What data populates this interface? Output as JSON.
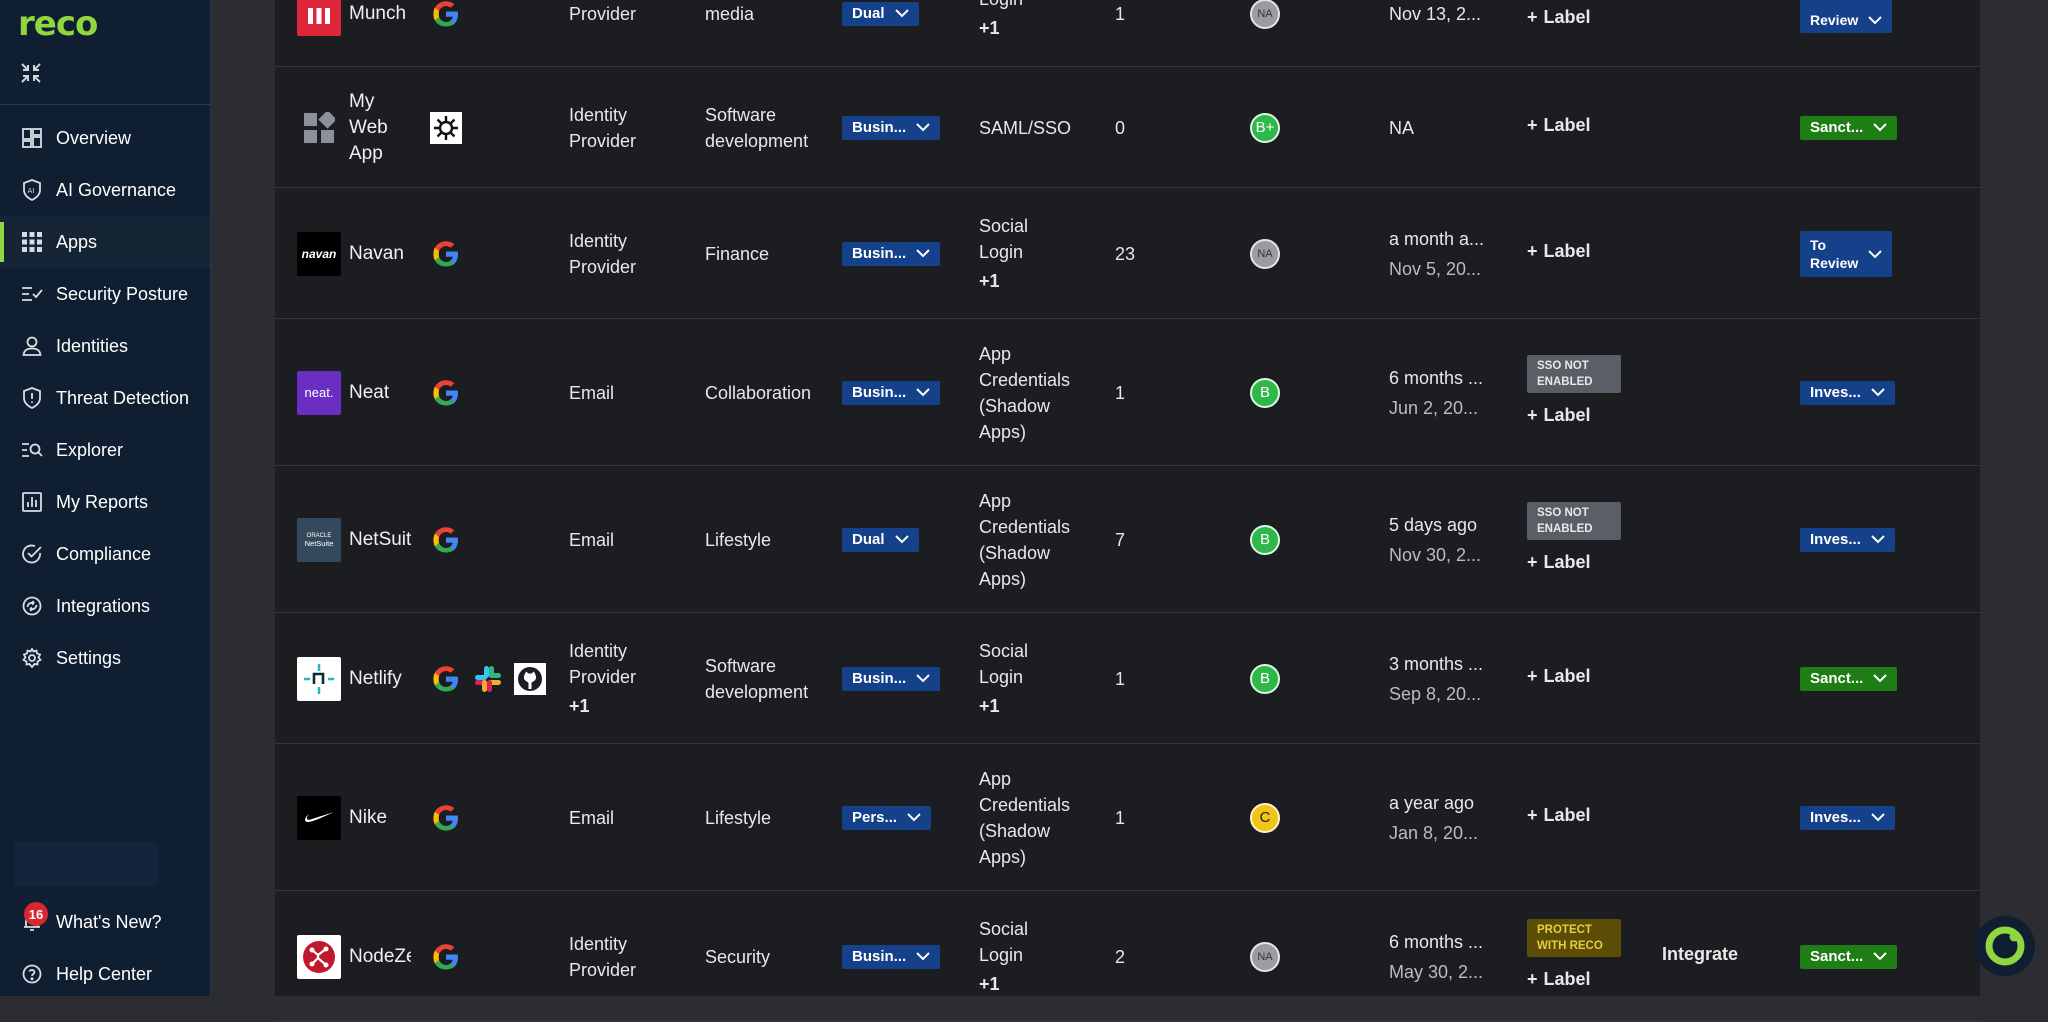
{
  "brand": {
    "logo_text": "reco",
    "accent": "#8fd640"
  },
  "sidebar": {
    "items": [
      {
        "label": "Overview",
        "icon": "dashboard-icon"
      },
      {
        "label": "AI Governance",
        "icon": "ai-shield-icon"
      },
      {
        "label": "Apps",
        "icon": "apps-grid-icon",
        "active": true
      },
      {
        "label": "Security Posture",
        "icon": "checklist-icon"
      },
      {
        "label": "Identities",
        "icon": "person-icon"
      },
      {
        "label": "Threat Detection",
        "icon": "alert-shield-icon"
      },
      {
        "label": "Explorer",
        "icon": "search-list-icon"
      },
      {
        "label": "My Reports",
        "icon": "bar-chart-icon"
      },
      {
        "label": "Compliance",
        "icon": "check-circle-icon"
      },
      {
        "label": "Integrations",
        "icon": "sync-icon"
      },
      {
        "label": "Settings",
        "icon": "gear-icon"
      }
    ],
    "whats_new": {
      "label": "What's New?",
      "badge": "16"
    },
    "help": {
      "label": "Help Center"
    }
  },
  "add_label": "Label",
  "rows": [
    {
      "name": "Munch",
      "logo": "munch",
      "idps": [
        "google"
      ],
      "type_lines": [
        "Provider"
      ],
      "type_more": "",
      "category_lines": [
        "media"
      ],
      "account": "Dual",
      "method_lines": [
        "Login"
      ],
      "method_more": "+1",
      "users": "1",
      "score": "NA",
      "last_lines": [
        "Nov 13, 2..."
      ],
      "tag": "",
      "integrate": "",
      "status": "Review",
      "status_two": "",
      "status_color": "blue"
    },
    {
      "name_lines": [
        "My",
        "Web",
        "App"
      ],
      "logo": "mywebapp",
      "idps": [
        "okta"
      ],
      "type_lines": [
        "Identity",
        "Provider"
      ],
      "type_more": "",
      "category_lines": [
        "Software",
        "development"
      ],
      "account": "Busin...",
      "method_lines": [
        "SAML/SSO"
      ],
      "method_more": "",
      "users": "0",
      "score": "B+",
      "last_lines": [
        "NA"
      ],
      "tag": "",
      "integrate": "",
      "status": "Sanct...",
      "status_color": "green"
    },
    {
      "name": "Navan",
      "logo": "navan",
      "logo_text": "navan",
      "idps": [
        "google"
      ],
      "type_lines": [
        "Identity",
        "Provider"
      ],
      "type_more": "",
      "category_lines": [
        "Finance"
      ],
      "account": "Busin...",
      "method_lines": [
        "Social",
        "Login"
      ],
      "method_more": "+1",
      "users": "23",
      "score": "NA",
      "last_lines": [
        "a month a...",
        "Nov 5, 20..."
      ],
      "tag": "",
      "integrate": "",
      "status": "To",
      "status_two": "Review",
      "status_color": "blue"
    },
    {
      "name": "Neat",
      "logo": "neat",
      "logo_text": "neat.",
      "idps": [
        "google"
      ],
      "type_lines": [
        "Email"
      ],
      "type_more": "",
      "category_lines": [
        "Collaboration"
      ],
      "account": "Busin...",
      "method_lines": [
        "App",
        "Credentials",
        "(Shadow",
        "Apps)"
      ],
      "method_more": "",
      "users": "1",
      "score": "B",
      "last_lines": [
        "6 months ...",
        "Jun 2, 20..."
      ],
      "tag_lines": [
        "SSO NOT",
        "ENABLED"
      ],
      "tag_color": "grey",
      "integrate": "",
      "status": "Inves...",
      "status_color": "blue"
    },
    {
      "name": "NetSuite",
      "logo": "netsuite",
      "logo_text_top": "ORACLE",
      "logo_text": "NetSuite",
      "idps": [
        "google"
      ],
      "type_lines": [
        "Email"
      ],
      "type_more": "",
      "category_lines": [
        "Lifestyle"
      ],
      "account": "Dual",
      "method_lines": [
        "App",
        "Credentials",
        "(Shadow",
        "Apps)"
      ],
      "method_more": "",
      "users": "7",
      "score": "B",
      "last_lines": [
        "5 days ago",
        "Nov 30, 2..."
      ],
      "tag_lines": [
        "SSO NOT",
        "ENABLED"
      ],
      "tag_color": "grey",
      "integrate": "",
      "status": "Inves...",
      "status_color": "blue"
    },
    {
      "name": "Netlify",
      "logo": "netlify",
      "idps": [
        "google",
        "slack",
        "github"
      ],
      "type_lines": [
        "Identity",
        "Provider"
      ],
      "type_more": "+1",
      "category_lines": [
        "Software",
        "development"
      ],
      "account": "Busin...",
      "method_lines": [
        "Social",
        "Login"
      ],
      "method_more": "+1",
      "users": "1",
      "score": "B",
      "last_lines": [
        "3 months ...",
        "Sep 8, 20..."
      ],
      "tag": "",
      "integrate": "",
      "status": "Sanct...",
      "status_color": "green"
    },
    {
      "name": "Nike",
      "logo": "nike",
      "idps": [
        "google"
      ],
      "type_lines": [
        "Email"
      ],
      "type_more": "",
      "category_lines": [
        "Lifestyle"
      ],
      "account": "Pers...",
      "method_lines": [
        "App",
        "Credentials",
        "(Shadow",
        "Apps)"
      ],
      "method_more": "",
      "users": "1",
      "score": "C",
      "last_lines": [
        "a year ago",
        "Jan 8, 20..."
      ],
      "tag": "",
      "integrate": "",
      "status": "Inves...",
      "status_color": "blue"
    },
    {
      "name": "NodeZero",
      "logo": "nodezero",
      "idps": [
        "google"
      ],
      "type_lines": [
        "Identity",
        "Provider"
      ],
      "type_more": "",
      "category_lines": [
        "Security"
      ],
      "account": "Busin...",
      "method_lines": [
        "Social",
        "Login"
      ],
      "method_more": "+1",
      "users": "2",
      "score": "NA",
      "last_lines": [
        "6 months ...",
        "May 30, 2..."
      ],
      "tag_lines": [
        "PROTECT",
        "WITH RECO"
      ],
      "tag_color": "yellow",
      "integrate": "Integrate",
      "status": "Sanct...",
      "status_color": "green"
    }
  ]
}
